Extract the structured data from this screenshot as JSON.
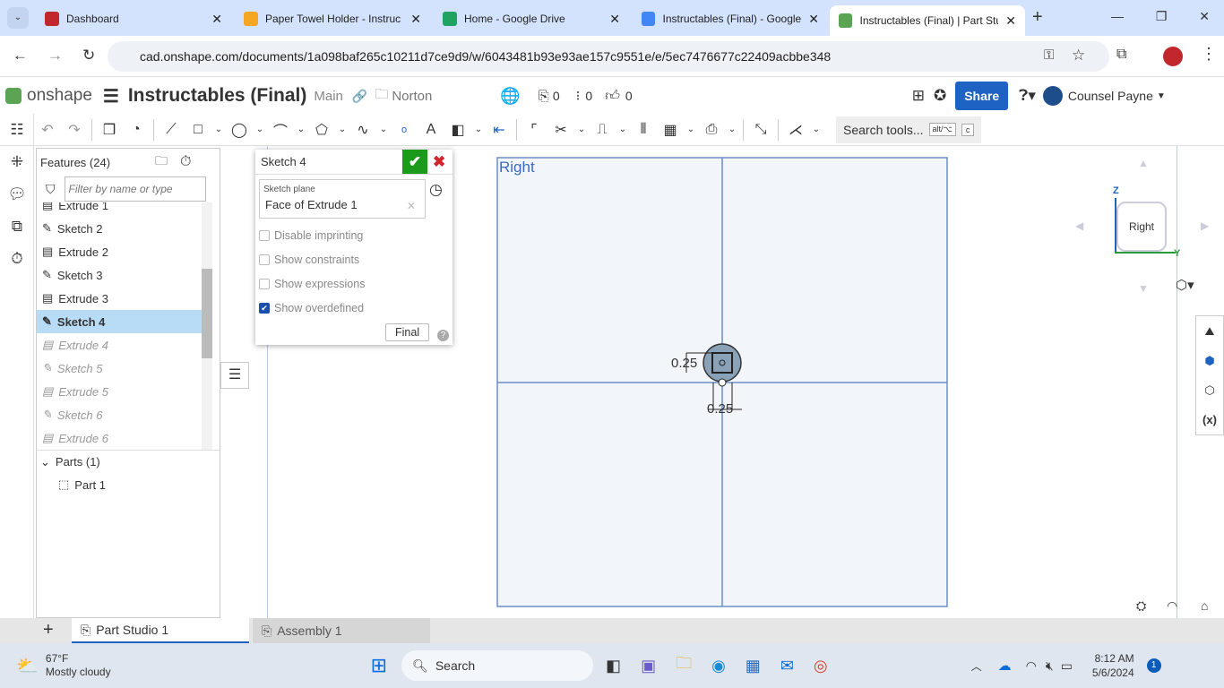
{
  "browser": {
    "tabs": [
      {
        "title": "Dashboard",
        "color": "#c1272d"
      },
      {
        "title": "Paper Towel Holder - Instruc",
        "color": "#f5a623"
      },
      {
        "title": "Home - Google Drive",
        "color": "#1ea362"
      },
      {
        "title": "Instructables (Final) - Google",
        "color": "#4285f4"
      },
      {
        "title": "Instructables (Final) | Part Stu",
        "color": "#5aa454",
        "active": true
      }
    ],
    "url": "cad.onshape.com/documents/1a098baf265c10211d7ce9d9/w/6043481b93e93ae157c9551e/e/5ec7476677c22409acbbe348"
  },
  "header": {
    "logo": "onshape",
    "doc_title": "Instructables (Final)",
    "branch": "Main",
    "folder": "Norton",
    "versions_count": "0",
    "comments_count": "0",
    "likes_count": "0",
    "share": "Share",
    "user": "Counsel Payne"
  },
  "toolbar": {
    "search_placeholder": "Search tools...",
    "shortcut1": "alt/⌥",
    "shortcut2": "c"
  },
  "features": {
    "title": "Features (24)",
    "filter_placeholder": "Filter by name or type",
    "items": [
      {
        "label": "Extrude 1",
        "type": "extrude"
      },
      {
        "label": "Sketch 2",
        "type": "sketch"
      },
      {
        "label": "Extrude 2",
        "type": "extrude"
      },
      {
        "label": "Sketch 3",
        "type": "sketch"
      },
      {
        "label": "Extrude 3",
        "type": "extrude"
      },
      {
        "label": "Sketch 4",
        "type": "sketch",
        "selected": true
      },
      {
        "label": "Extrude 4",
        "type": "extrude",
        "rolled_back": true
      },
      {
        "label": "Sketch 5",
        "type": "sketch",
        "rolled_back": true
      },
      {
        "label": "Extrude 5",
        "type": "extrude",
        "rolled_back": true
      },
      {
        "label": "Sketch 6",
        "type": "sketch",
        "rolled_back": true
      },
      {
        "label": "Extrude 6",
        "type": "extrude",
        "rolled_back": true
      }
    ],
    "parts_header": "Parts (1)",
    "parts": [
      "Part 1"
    ]
  },
  "sketch_dialog": {
    "title": "Sketch 4",
    "plane_label": "Sketch plane",
    "plane_value": "Face of Extrude 1",
    "options": [
      {
        "label": "Disable imprinting",
        "checked": false
      },
      {
        "label": "Show constraints",
        "checked": false
      },
      {
        "label": "Show expressions",
        "checked": false
      },
      {
        "label": "Show overdefined",
        "checked": true
      }
    ],
    "final_button": "Final"
  },
  "viewport": {
    "plane_label": "Right",
    "dim1": "0.25",
    "dim2": "0.25",
    "view_cube_label": "Right",
    "axis_z": "Z",
    "axis_y": "Y"
  },
  "bottom_tabs": [
    {
      "label": "Part Studio 1",
      "active": true
    },
    {
      "label": "Assembly 1"
    }
  ],
  "taskbar": {
    "temp": "67°F",
    "weather": "Mostly cloudy",
    "search": "Search",
    "time": "8:12 AM",
    "date": "5/6/2024",
    "notifications": "1"
  }
}
